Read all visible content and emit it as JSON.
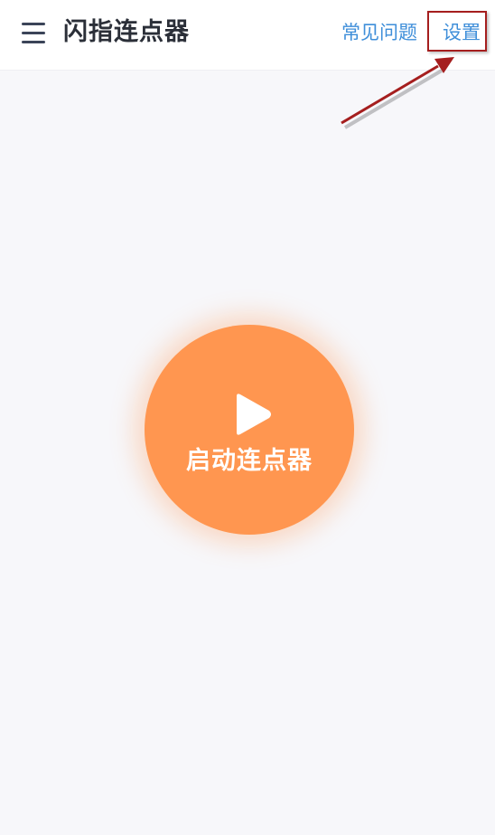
{
  "app_bar": {
    "menu_icon": "hamburger-menu-icon",
    "title": "闪指连点器",
    "faq_label": "常见问题",
    "settings_label": "设置"
  },
  "main": {
    "start_icon": "play-icon",
    "start_label": "启动连点器"
  },
  "annotation": {
    "highlight_target": "设置",
    "arrow_icon": "red-arrow-icon"
  },
  "colors": {
    "background": "#f7f7fa",
    "app_bar": "#ffffff",
    "title": "#2b2f38",
    "link": "#3e8ed9",
    "start_button": "#ff9650",
    "annotation": "#a51e1e"
  }
}
